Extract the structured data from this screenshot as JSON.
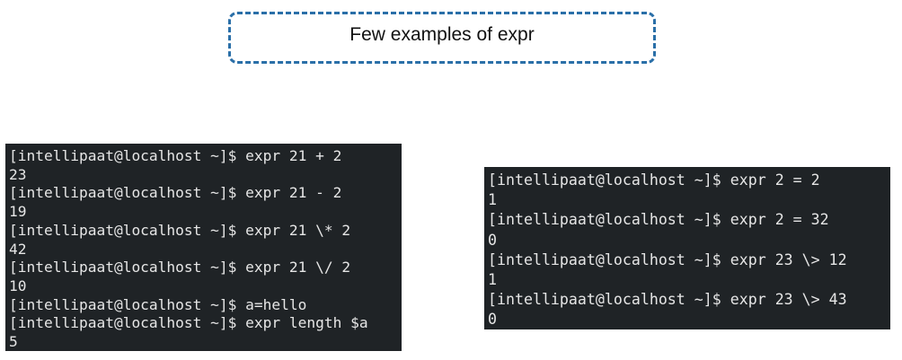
{
  "title": "Few examples of expr",
  "colors": {
    "title_border": "#2a6fa8",
    "terminal_bg": "#1f2326",
    "terminal_text": "#e6e6e6"
  },
  "left_terminal": {
    "lines": [
      "[intellipaat@localhost ~]$ expr 21 + 2",
      "23",
      "[intellipaat@localhost ~]$ expr 21 - 2",
      "19",
      "[intellipaat@localhost ~]$ expr 21 \\* 2",
      "42",
      "[intellipaat@localhost ~]$ expr 21 \\/ 2",
      "10",
      "[intellipaat@localhost ~]$ a=hello",
      "[intellipaat@localhost ~]$ expr length $a",
      "5"
    ]
  },
  "right_terminal": {
    "lines": [
      "[intellipaat@localhost ~]$ expr 2 = 2",
      "1",
      "[intellipaat@localhost ~]$ expr 2 = 32",
      "0",
      "[intellipaat@localhost ~]$ expr 23 \\> 12",
      "1",
      "[intellipaat@localhost ~]$ expr 23 \\> 43",
      "0"
    ]
  }
}
